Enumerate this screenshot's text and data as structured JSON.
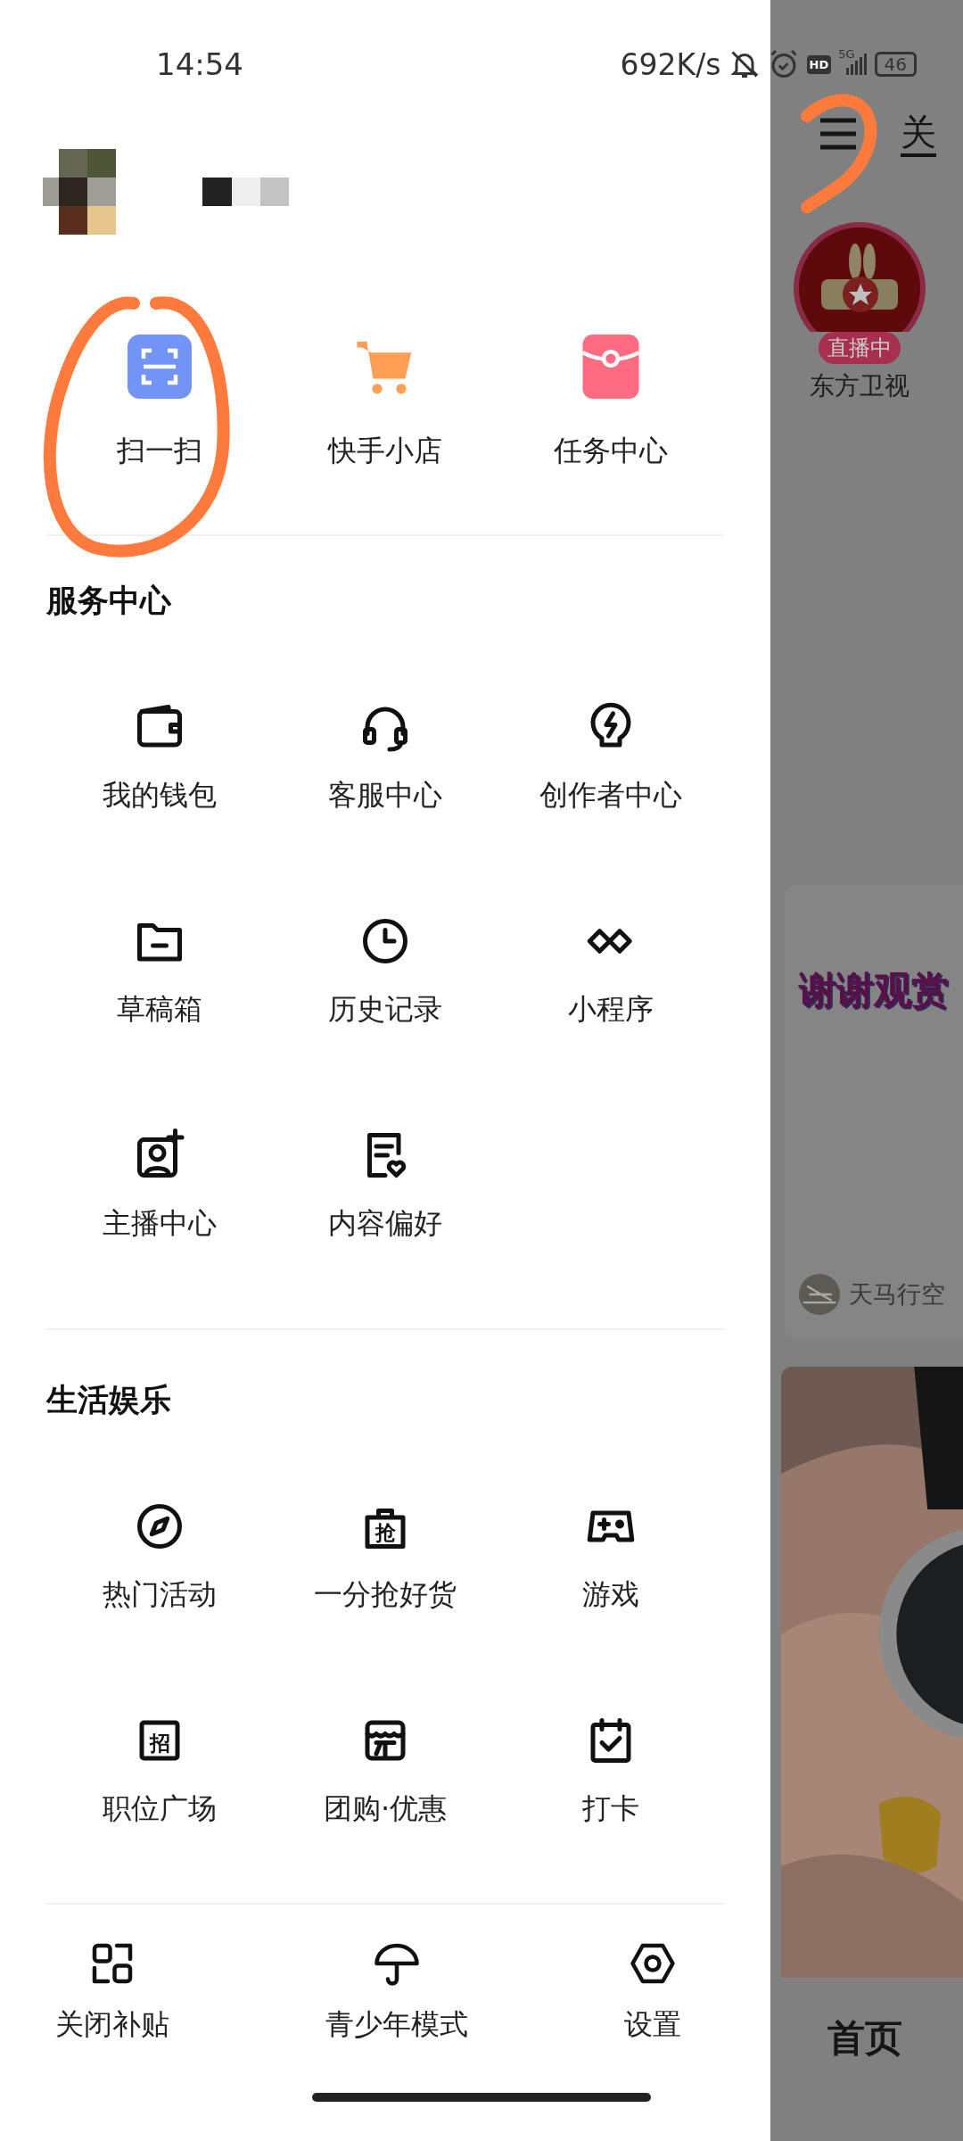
{
  "status_bar": {
    "time": "14:54",
    "speed": "692K/s",
    "hd": "HD",
    "network": "5G",
    "battery": "46"
  },
  "shortcuts": [
    {
      "label": "扫一扫"
    },
    {
      "label": "快手小店"
    },
    {
      "label": "任务中心"
    }
  ],
  "sections": [
    {
      "title": "服务中心",
      "items": [
        {
          "label": "我的钱包"
        },
        {
          "label": "客服中心"
        },
        {
          "label": "创作者中心"
        },
        {
          "label": "草稿箱"
        },
        {
          "label": "历史记录"
        },
        {
          "label": "小程序"
        },
        {
          "label": "主播中心"
        },
        {
          "label": "内容偏好"
        }
      ]
    },
    {
      "title": "生活娱乐",
      "items": [
        {
          "label": "热门活动"
        },
        {
          "label": "一分抢好货",
          "icon_text": "抢"
        },
        {
          "label": "游戏"
        },
        {
          "label": "职位广场",
          "icon_text": "招"
        },
        {
          "label": "团购·优惠"
        },
        {
          "label": "打卡"
        }
      ]
    }
  ],
  "bottom_bar": [
    {
      "label": "关闭补贴"
    },
    {
      "label": "青少年模式"
    },
    {
      "label": "设置"
    }
  ],
  "background_feed": {
    "tab": "关",
    "live": {
      "badge": "直播中",
      "name": "东方卫视"
    },
    "card": {
      "caption": "谢谢观赏",
      "author": "天马行空"
    },
    "nav": "首页"
  }
}
